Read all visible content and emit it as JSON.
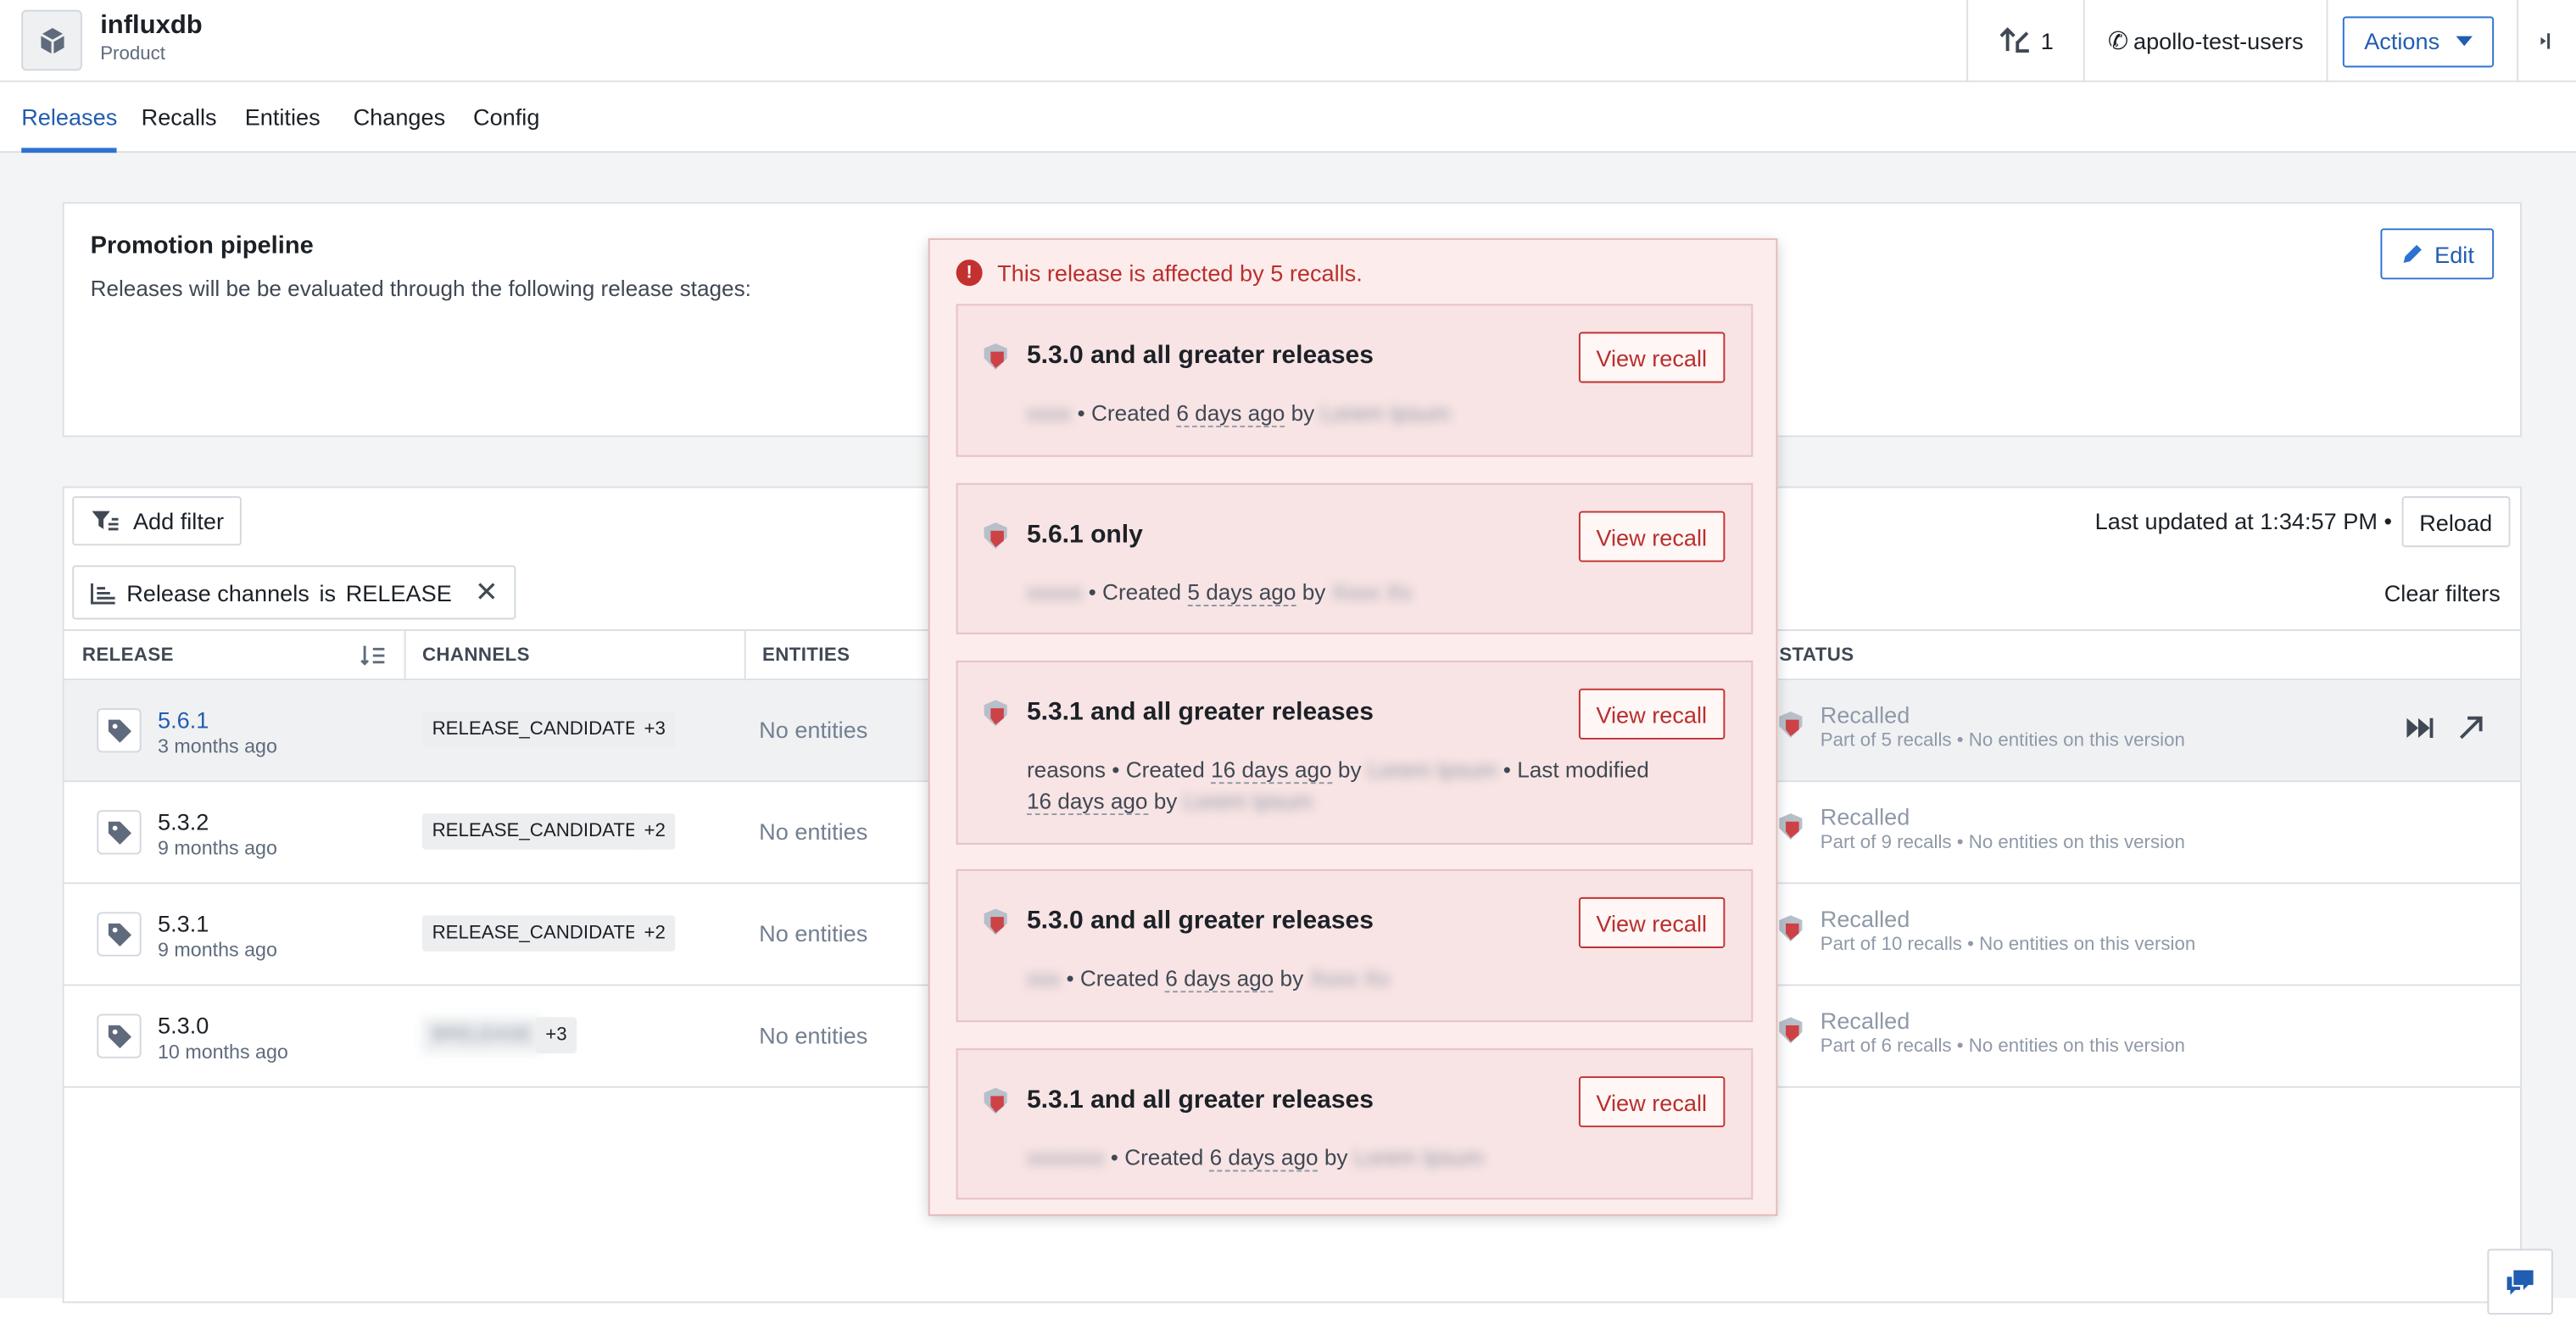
{
  "header": {
    "product_name": "influxdb",
    "product_type": "Product",
    "notifications_count": "1",
    "on_call_team": "apollo-test-users",
    "actions_label": "Actions"
  },
  "tabs": [
    {
      "label": "Releases"
    },
    {
      "label": "Recalls"
    },
    {
      "label": "Entities"
    },
    {
      "label": "Changes"
    },
    {
      "label": "Config"
    }
  ],
  "pipeline": {
    "title": "Promotion pipeline",
    "description": "Releases will be be evaluated through the following release stages:",
    "edit_label": "Edit"
  },
  "toolbar": {
    "add_filter_label": "Add filter",
    "last_updated": "Last updated at 1:34:57 PM •",
    "reload_label": "Reload",
    "filter_field": "Release channels",
    "filter_op": "is",
    "filter_value": "RELEASE",
    "clear_filters_label": "Clear filters"
  },
  "table": {
    "columns": {
      "release": "RELEASE",
      "channels": "CHANNELS",
      "entities": "ENTITIES",
      "status": "STATUS"
    },
    "rows": [
      {
        "version": "5.6.1",
        "age": "3 months ago",
        "channel": "RELEASE_CANDIDATE",
        "more": "+3",
        "entities": "No entities",
        "status": "Recalled",
        "status_detail": "Part of 5 recalls • No entities on this version"
      },
      {
        "version": "5.3.2",
        "age": "9 months ago",
        "channel": "RELEASE_CANDIDATE",
        "more": "+2",
        "entities": "No entities",
        "status": "Recalled",
        "status_detail": "Part of 9 recalls • No entities on this version"
      },
      {
        "version": "5.3.1",
        "age": "9 months ago",
        "channel": "RELEASE_CANDIDATE",
        "more": "+2",
        "entities": "No entities",
        "status": "Recalled",
        "status_detail": "Part of 10 recalls • No entities on this version"
      },
      {
        "version": "5.3.0",
        "age": "10 months ago",
        "channel": "BRELEASE",
        "more": "+3",
        "entities": "No entities",
        "status": "Recalled",
        "status_detail": "Part of 6 recalls • No entities on this version"
      }
    ]
  },
  "popover": {
    "header": "This release is affected by 5 recalls.",
    "view_label": "View recall",
    "recalls": [
      {
        "title": "5.3.0 and all greater releases",
        "reason": "xxxx",
        "created_prefix": "• Created",
        "created": "6 days ago",
        "by": "by",
        "author": "Lorem Ipsum"
      },
      {
        "title": "5.6.1 only",
        "reason": "xxxxx",
        "created_prefix": "• Created",
        "created": "5 days ago",
        "by": "by",
        "author": "Xxxx Xx"
      },
      {
        "title": "5.3.1 and all greater releases",
        "reason": "reasons",
        "created_prefix": "• Created",
        "created": "16 days ago",
        "by": "by",
        "author": "Lorem Ipsum",
        "modified_prefix": "• Last modified",
        "modified": "16 days ago",
        "modified_by": "by",
        "modifier": "Lorem Ipsum"
      },
      {
        "title": "5.3.0 and all greater releases",
        "reason": "xxx",
        "created_prefix": "• Created",
        "created": "6 days ago",
        "by": "by",
        "author": "Xxxx Xx"
      },
      {
        "title": "5.3.1 and all greater releases",
        "reason": "xxxxxxx",
        "created_prefix": "• Created",
        "created": "6 days ago",
        "by": "by",
        "author": "Lorem Ipsum"
      }
    ]
  },
  "colors": {
    "accent": "#2d72d2",
    "danger": "#c23030",
    "popover_bg": "#fdecec"
  },
  "icons": [
    "cube-icon",
    "upload-icon",
    "phone-icon",
    "caret-down-icon",
    "sidebar-toggle-icon",
    "pencil-icon",
    "filter-add-icon",
    "sort-icon",
    "tag-icon",
    "recall-shield-icon",
    "fast-forward-icon",
    "external-link-icon",
    "info-icon",
    "close-icon",
    "chat-icon"
  ]
}
